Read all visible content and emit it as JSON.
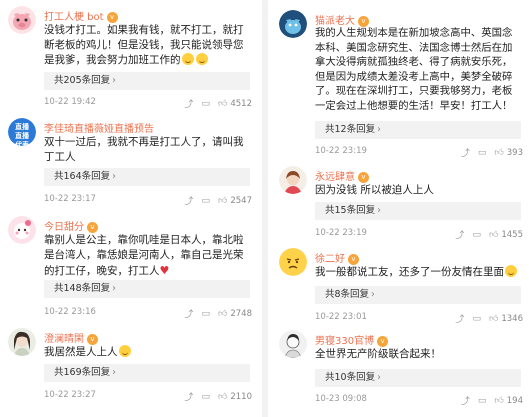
{
  "left": [
    {
      "name": "打工人梗 bot",
      "text": "没钱才打工。如果我有钱，就不打工，就打断老板的鸡儿！但是没钱，我只能说领导您是我爹，我会努力加班工作的",
      "replies": "共205条回复",
      "time": "10-22 19:42",
      "likes": "4512"
    },
    {
      "name": "李佳琦直播薇娅直播预告",
      "text": "双十一过后，我就不再是打工人了，请叫我丁工人",
      "replies": "共164条回复",
      "time": "10-22 23:17",
      "likes": "2547"
    },
    {
      "name": "今日甜分",
      "text": "靠别人是公主，靠你叽哇是日本人，靠北啦是台湾人，靠恁娘是河南人，靠自己是光荣的打工仔，晚安，打工人",
      "replies": "共148条回复",
      "time": "10-22 23:16",
      "likes": "2748"
    },
    {
      "name": "澄澜晴閑",
      "text": "我居然是人上人",
      "replies": "共169条回复",
      "time": "10-22 23:27",
      "likes": "2110"
    }
  ],
  "right": [
    {
      "name": "猫派老大",
      "text": "我的人生规划本是在新加坡念高中、英国念本科、美国念研究生、法国念博士然后在加拿大没得病就孤独终老、得了病就安乐死，但是因为成绩太差没考上高中，美梦全破碎了。现在在深圳打工，只要我够努力，老板一定会过上他想要的生活！早安！打工人！",
      "replies": "共12条回复",
      "time": "10-22 23:19",
      "likes": "393"
    },
    {
      "name": "永远肆意",
      "text": "因为没钱 所以被迫人上人",
      "replies": "共15条回复",
      "time": "10-22 23:19",
      "likes": "1455"
    },
    {
      "name": "徐二好",
      "text": "我一般都说工友，还多了一份友情在里面",
      "replies": "共8条回复",
      "time": "10-22 23:01",
      "likes": "1346"
    },
    {
      "name": "男寝330官博",
      "text": "全世界无产阶级联合起来！",
      "replies": "共10条回复",
      "time": "10-23 09:08",
      "likes": "194"
    }
  ],
  "icons": {
    "share": "share-icon",
    "comment": "comment-icon",
    "like": "thumbs-up-icon",
    "verified": "verified-badge-icon"
  },
  "colors": {
    "name": "#eb7350",
    "badge": "#f7a43b",
    "reply_bg": "#f2f2f2",
    "heart": "#e2323e"
  }
}
